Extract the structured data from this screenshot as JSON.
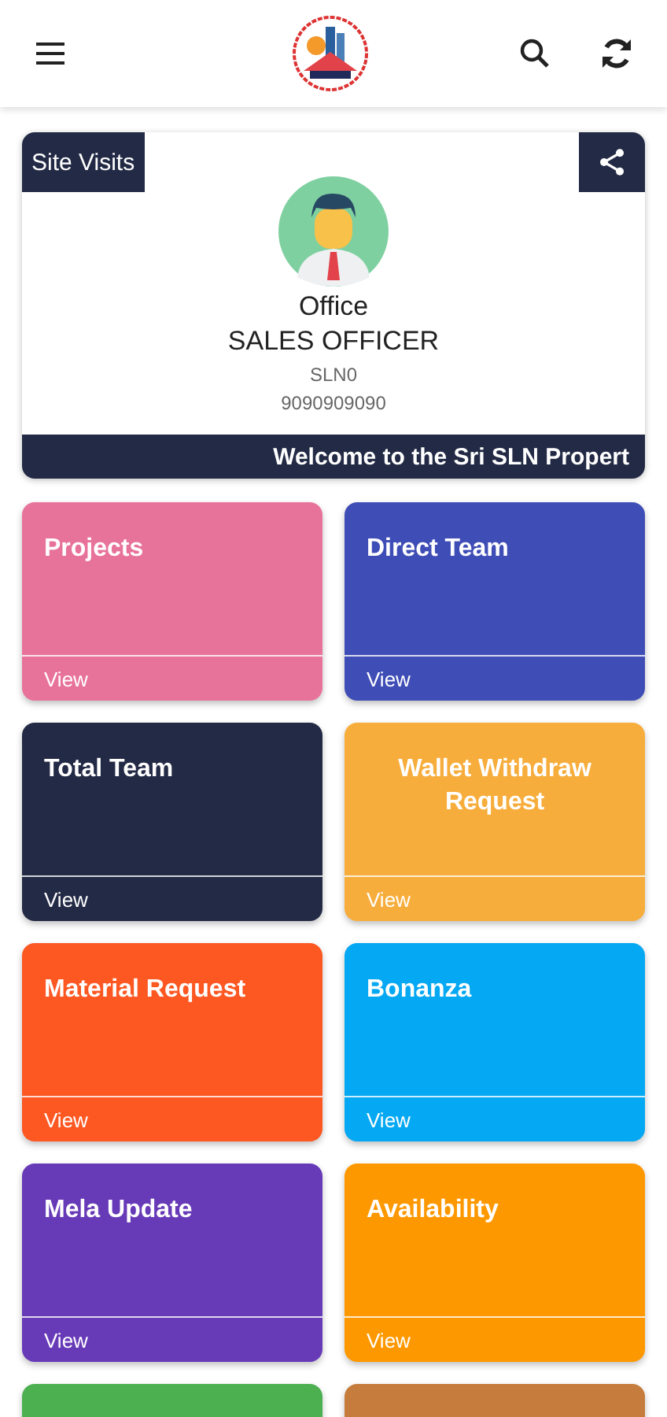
{
  "profile": {
    "badge": "Site Visits",
    "name": "Office",
    "role": "SALES OFFICER",
    "code": "SLN0",
    "phone": "9090909090",
    "marquee": "Welcome to the Sri SLN Propert"
  },
  "tiles": [
    {
      "title": "Projects",
      "link": "View",
      "color": "#e8739a",
      "centered": false
    },
    {
      "title": "Direct Team",
      "link": "View",
      "color": "#3f4db6",
      "centered": false
    },
    {
      "title": "Total Team",
      "link": "View",
      "color": "#232a45",
      "centered": false
    },
    {
      "title": "Wallet Withdraw Request",
      "link": "View",
      "color": "#f7ad3b",
      "centered": true
    },
    {
      "title": "Material Request",
      "link": "View",
      "color": "#fd5722",
      "centered": false
    },
    {
      "title": "Bonanza",
      "link": "View",
      "color": "#05a8f2",
      "centered": false
    },
    {
      "title": "Mela Update",
      "link": "View",
      "color": "#673ab8",
      "centered": false
    },
    {
      "title": "Availability",
      "link": "View",
      "color": "#fe9800",
      "centered": false
    },
    {
      "color": "#4caf50"
    },
    {
      "color": "#c67c3c"
    }
  ]
}
